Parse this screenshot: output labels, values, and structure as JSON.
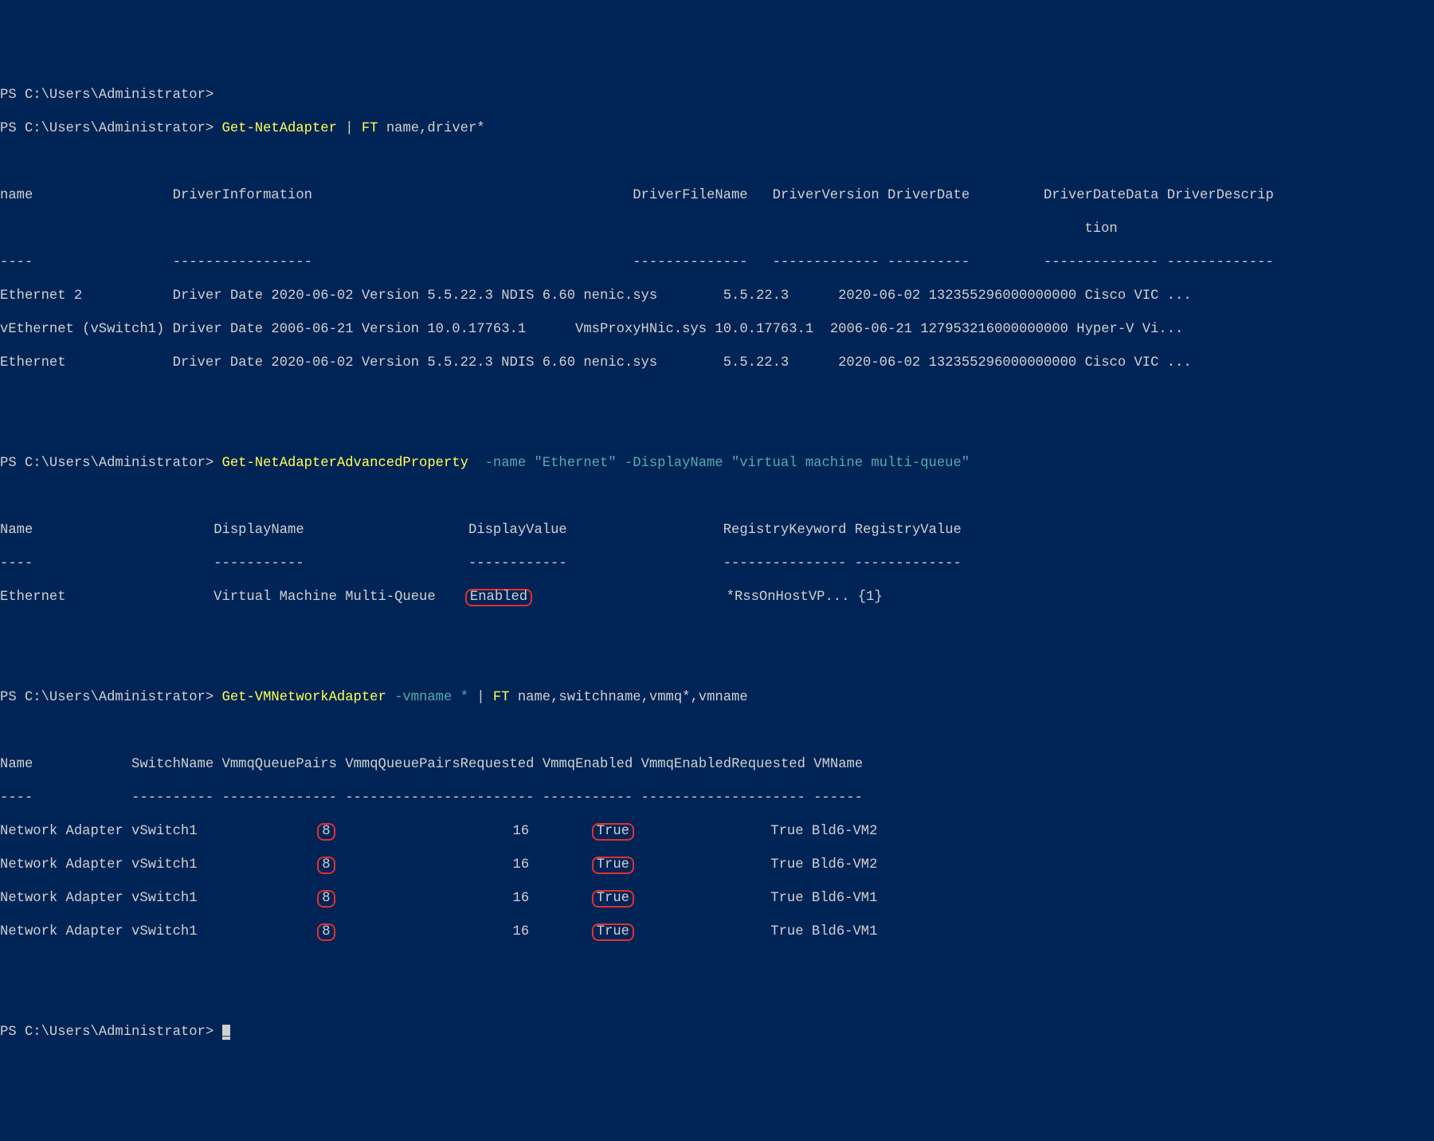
{
  "prompt": "PS C:\\Users\\Administrator>",
  "blank_prompt_line": "PS C:\\Users\\Administrator>",
  "block1": {
    "cmd_main": "Get-NetAdapter",
    "cmd_pipe": " | ",
    "cmd_ft": "FT",
    "cmd_args": " name,driver*",
    "header": {
      "name": "name",
      "driverInformation": "DriverInformation",
      "driverFileName": "DriverFileName",
      "driverVersion": "DriverVersion",
      "driverDate": "DriverDate",
      "driverDateData": "DriverDateData",
      "driverDescription_line1": "DriverDescrip",
      "driverDescription_line2": "tion"
    },
    "rows": [
      {
        "name": "Ethernet 2",
        "driverInformation": "Driver Date 2020-06-02 Version 5.5.22.3 NDIS 6.60",
        "driverFileName": "nenic.sys",
        "driverVersion": "5.5.22.3",
        "driverDate": "2020-06-02",
        "driverDateData": "132355296000000000",
        "driverDescription": "Cisco VIC ..."
      },
      {
        "name": "vEthernet (vSwitch1)",
        "driverInformation": "Driver Date 2006-06-21 Version 10.0.17763.1",
        "driverFileName": "VmsProxyHNic.sys",
        "driverVersion": "10.0.17763.1",
        "driverDate": "2006-06-21",
        "driverDateData": "127953216000000000",
        "driverDescription": "Hyper-V Vi..."
      },
      {
        "name": "Ethernet",
        "driverInformation": "Driver Date 2020-06-02 Version 5.5.22.3 NDIS 6.60",
        "driverFileName": "nenic.sys",
        "driverVersion": "5.5.22.3",
        "driverDate": "2020-06-02",
        "driverDateData": "132355296000000000",
        "driverDescription": "Cisco VIC ..."
      }
    ]
  },
  "block2": {
    "cmd_main": "Get-NetAdapterAdvancedProperty",
    "cmd_args": "  -name \"Ethernet\" -DisplayName \"virtual machine multi-queue\"",
    "header": {
      "name": "Name",
      "displayName": "DisplayName",
      "displayValue": "DisplayValue",
      "registryKeyword": "RegistryKeyword",
      "registryValue": "RegistryValue"
    },
    "rows": [
      {
        "name": "Ethernet",
        "displayName": "Virtual Machine Multi-Queue",
        "displayValue": "Enabled",
        "registryKeyword": "*RssOnHostVP...",
        "registryValue": "{1}"
      }
    ]
  },
  "block3": {
    "cmd_main": "Get-VMNetworkAdapter",
    "cmd_args1": " -vmname *",
    "cmd_pipe": " | ",
    "cmd_ft": "FT",
    "cmd_args2": " name,switchname,vmmq*,vmname",
    "header": {
      "name": "Name",
      "switchName": "SwitchName",
      "vmmqQueuePairs": "VmmqQueuePairs",
      "vmmqQueuePairsRequested": "VmmqQueuePairsRequested",
      "vmmqEnabled": "VmmqEnabled",
      "vmmqEnabledRequested": "VmmqEnabledRequested",
      "vmname": "VMName"
    },
    "rows": [
      {
        "name": "Network Adapter",
        "switchName": "vSwitch1",
        "vmmqQueuePairs": "8",
        "vmmqQueuePairsRequested": "16",
        "vmmqEnabled": "True",
        "vmmqEnabledRequested": "True",
        "vmname": "Bld6-VM2"
      },
      {
        "name": "Network Adapter",
        "switchName": "vSwitch1",
        "vmmqQueuePairs": "8",
        "vmmqQueuePairsRequested": "16",
        "vmmqEnabled": "True",
        "vmmqEnabledRequested": "True",
        "vmname": "Bld6-VM2"
      },
      {
        "name": "Network Adapter",
        "switchName": "vSwitch1",
        "vmmqQueuePairs": "8",
        "vmmqQueuePairsRequested": "16",
        "vmmqEnabled": "True",
        "vmmqEnabledRequested": "True",
        "vmname": "Bld6-VM1"
      },
      {
        "name": "Network Adapter",
        "switchName": "vSwitch1",
        "vmmqQueuePairs": "8",
        "vmmqQueuePairsRequested": "16",
        "vmmqEnabled": "True",
        "vmmqEnabledRequested": "True",
        "vmname": "Bld6-VM1"
      }
    ]
  },
  "cursor": "_"
}
